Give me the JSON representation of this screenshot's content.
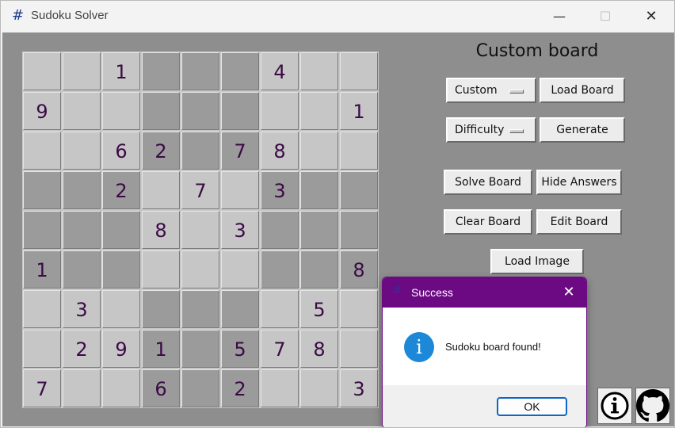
{
  "window": {
    "title": "Sudoku Solver",
    "app_icon": "#",
    "minimize": "—",
    "maximize": "☐",
    "close": "✕"
  },
  "board": {
    "values": [
      [
        "",
        "",
        "1",
        "",
        "",
        "",
        "4",
        "",
        ""
      ],
      [
        "9",
        "",
        "",
        "",
        "",
        "",
        "",
        "",
        "1"
      ],
      [
        "",
        "",
        "6",
        "2",
        "",
        "7",
        "8",
        "",
        ""
      ],
      [
        "",
        "",
        "2",
        "",
        "7",
        "",
        "3",
        "",
        ""
      ],
      [
        "",
        "",
        "",
        "8",
        "",
        "3",
        "",
        "",
        ""
      ],
      [
        "1",
        "",
        "",
        "",
        "",
        "",
        "",
        "",
        "8"
      ],
      [
        "",
        "3",
        "",
        "",
        "",
        "",
        "",
        "5",
        ""
      ],
      [
        "",
        "2",
        "9",
        "1",
        "",
        "5",
        "7",
        "8",
        ""
      ],
      [
        "7",
        "",
        "",
        "6",
        "",
        "2",
        "",
        "",
        "3"
      ]
    ],
    "colors": {
      "light": "#c6c6c6",
      "dark": "#9b9b9b",
      "digit": "#3b0a45"
    }
  },
  "panel": {
    "title": "Custom board",
    "board_select": "Custom",
    "load_board": "Load Board",
    "difficulty_select": "Difficulty",
    "generate": "Generate",
    "solve_board": "Solve Board",
    "hide_answers": "Hide Answers",
    "clear_board": "Clear Board",
    "edit_board": "Edit Board",
    "load_image": "Load Image"
  },
  "dialog": {
    "title": "Success",
    "message": "Sudoku board found!",
    "ok": "OK",
    "close": "✕",
    "info_glyph": "i",
    "title_icon": "#",
    "accent": "#6b0a83"
  },
  "icons": {
    "info": "info-icon",
    "github": "github-icon"
  }
}
